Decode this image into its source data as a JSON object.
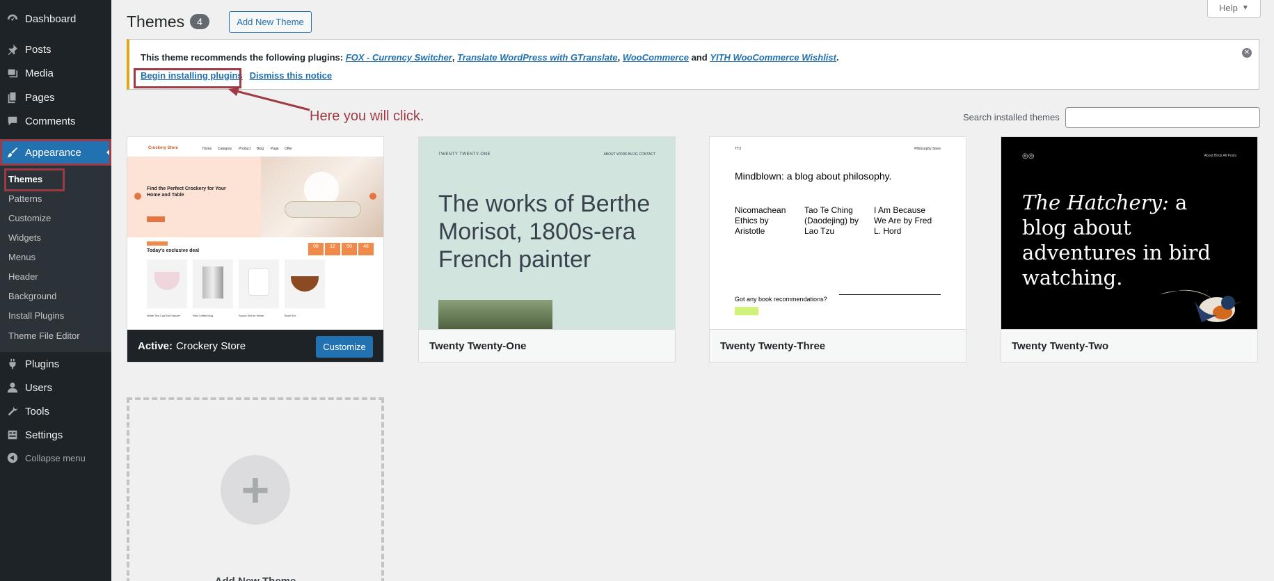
{
  "sidebar": {
    "items": [
      {
        "label": "Dashboard",
        "icon": "dashboard-icon"
      },
      {
        "label": "Posts",
        "icon": "pin-icon"
      },
      {
        "label": "Media",
        "icon": "media-icon"
      },
      {
        "label": "Pages",
        "icon": "pages-icon"
      },
      {
        "label": "Comments",
        "icon": "comment-icon"
      },
      {
        "label": "Appearance",
        "icon": "brush-icon"
      },
      {
        "label": "Plugins",
        "icon": "plug-icon"
      },
      {
        "label": "Users",
        "icon": "user-icon"
      },
      {
        "label": "Tools",
        "icon": "wrench-icon"
      },
      {
        "label": "Settings",
        "icon": "settings-icon"
      }
    ],
    "submenu": [
      "Themes",
      "Patterns",
      "Customize",
      "Widgets",
      "Menus",
      "Header",
      "Background",
      "Install Plugins",
      "Theme File Editor"
    ],
    "collapse_label": "Collapse menu"
  },
  "header": {
    "title": "Themes",
    "count": "4",
    "add_new_label": "Add New Theme",
    "help_label": "Help"
  },
  "notice": {
    "prefix": "This theme recommends the following plugins:",
    "plugins": [
      "FOX - Currency Switcher",
      "Translate WordPress with GTranslate",
      "WooCommerce",
      "YITH WooCommerce Wishlist"
    ],
    "and": "and",
    "begin_label": "Begin installing plugins",
    "dismiss_label": "Dismiss this notice"
  },
  "annotation": "Here you will click.",
  "search": {
    "label": "Search installed themes",
    "value": ""
  },
  "themes": [
    {
      "name": "Crockery Store",
      "active_prefix": "Active:",
      "customize_label": "Customize"
    },
    {
      "name": "Twenty Twenty-One",
      "preview_title": "The works of Berthe Morisot, 1800s-era French painter",
      "preview_site": "TWENTY TWENTY-ONE",
      "preview_nav": "ABOUT   WORK   BLOG   CONTACT"
    },
    {
      "name": "Twenty Twenty-Three",
      "preview_title": "Mindblown: a blog about philosophy.",
      "preview_posts": [
        "Nicomachean Ethics by Aristotle",
        "Tao Te Ching (Daodejing) by Lao Tzu",
        "I Am Because We Are by Fred L. Hord"
      ],
      "preview_footer": "Got any book recommendations?",
      "preview_site": "TT3",
      "preview_nav": "Philosophy   Store"
    },
    {
      "name": "Twenty Twenty-Two",
      "preview_title_em": "The Hatchery:",
      "preview_title_rest": " a blog about adventures in bird watching.",
      "preview_nav": "About     Birds     All Posts"
    }
  ],
  "crockery_preview": {
    "hero_title": "Find the Perfect Crockery for Your Home and Table",
    "deal_title": "Today's exclusive deal",
    "timer": [
      "06",
      "12",
      "50",
      "46"
    ],
    "products": [
      "White Tea Cup And Saucer",
      "Red Coffee Mug",
      "Spoon Set for Home",
      "Bowl Set"
    ],
    "logo": "Crockery Store",
    "nav": [
      "Home",
      "Category",
      "Product",
      "Blog",
      "Page",
      "Offer"
    ]
  },
  "add_tile_label": "Add New Theme",
  "colors": {
    "sidebar_bg": "#1d2327",
    "accent": "#2271b1",
    "notice_border": "#dba617",
    "highlight": "#9e3a44"
  }
}
